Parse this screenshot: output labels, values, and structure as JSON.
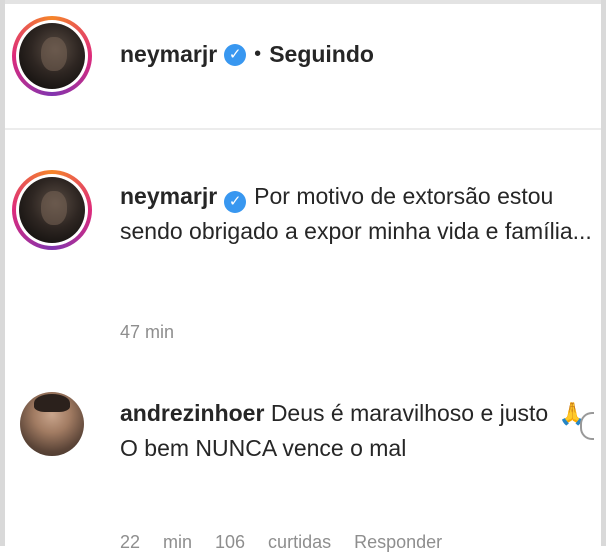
{
  "post_header": {
    "username": "neymarjr",
    "separator": "•",
    "follow_status": "Seguindo"
  },
  "caption": {
    "username": "neymarjr",
    "text": "Por motivo de extorsão estou sendo obrigado a expor minha vida e família...",
    "time": "47 min"
  },
  "comment": {
    "username": "andrezinhoer",
    "line1": "Deus é maravilhoso e justo",
    "emoji": "🙏",
    "line2": "O bem NUNCA vence o mal",
    "meta": "22 min 106 curtidas Responder"
  },
  "icons": {
    "verified": "verified-badge-icon",
    "heart": "heart-icon"
  },
  "colors": {
    "verified": "#3897f0",
    "muted": "#8e8e8e"
  }
}
